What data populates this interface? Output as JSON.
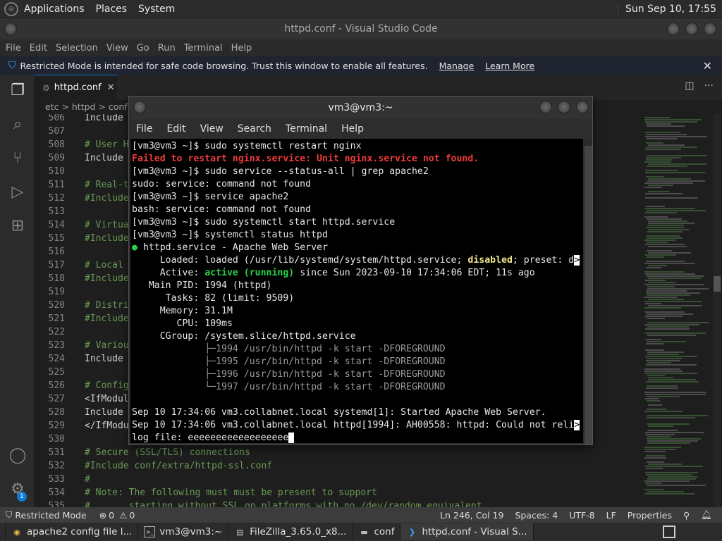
{
  "topbar": {
    "menus": [
      "Applications",
      "Places",
      "System"
    ],
    "clock": "Sun Sep 10, 17:55"
  },
  "window": {
    "title": "httpd.conf - Visual Studio Code"
  },
  "menubar": [
    "File",
    "Edit",
    "Selection",
    "View",
    "Go",
    "Run",
    "Terminal",
    "Help"
  ],
  "banner": {
    "text": "Restricted Mode is intended for safe code browsing. Trust this window to enable all features.",
    "manage": "Manage",
    "learn": "Learn More"
  },
  "tab": {
    "label": "httpd.conf"
  },
  "breadcrumb": "etc > httpd > conf >",
  "editor": {
    "lines": [
      {
        "n": "506",
        "t": "Include",
        "c": false
      },
      {
        "n": "507",
        "t": "",
        "c": false
      },
      {
        "n": "508",
        "t": "# User H",
        "c": true
      },
      {
        "n": "509",
        "t": "Include ",
        "c": false
      },
      {
        "n": "510",
        "t": "",
        "c": false
      },
      {
        "n": "511",
        "t": "# Real-t",
        "c": true
      },
      {
        "n": "512",
        "t": "#Include",
        "c": true
      },
      {
        "n": "513",
        "t": "",
        "c": false
      },
      {
        "n": "514",
        "t": "# Virtua",
        "c": true
      },
      {
        "n": "515",
        "t": "#Include",
        "c": true
      },
      {
        "n": "516",
        "t": "",
        "c": false
      },
      {
        "n": "517",
        "t": "# Local ",
        "c": true
      },
      {
        "n": "518",
        "t": "#Include",
        "c": true
      },
      {
        "n": "519",
        "t": "",
        "c": false
      },
      {
        "n": "520",
        "t": "# Distri",
        "c": true
      },
      {
        "n": "521",
        "t": "#Include",
        "c": true
      },
      {
        "n": "522",
        "t": "",
        "c": false
      },
      {
        "n": "523",
        "t": "# Variou",
        "c": true
      },
      {
        "n": "524",
        "t": "Include ",
        "c": false
      },
      {
        "n": "525",
        "t": "",
        "c": false
      },
      {
        "n": "526",
        "t": "# Config",
        "c": true
      },
      {
        "n": "527",
        "t": "<IfModul",
        "c": false
      },
      {
        "n": "528",
        "t": "Include ",
        "c": false
      },
      {
        "n": "529",
        "t": "</IfModu",
        "c": false
      },
      {
        "n": "530",
        "t": "",
        "c": false
      },
      {
        "n": "531",
        "t": "# Secure (SSL/TLS) connections",
        "c": true
      },
      {
        "n": "532",
        "t": "#Include conf/extra/httpd-ssl.conf",
        "c": true
      },
      {
        "n": "533",
        "t": "#",
        "c": true
      },
      {
        "n": "534",
        "t": "# Note: The following must must be present to support",
        "c": true
      },
      {
        "n": "535",
        "t": "#       starting without SSL on platforms with no /dev/random equivalent",
        "c": true
      }
    ]
  },
  "status": {
    "restricted": "Restricted Mode",
    "problems": "0",
    "warnings": "0",
    "position": "Ln 246, Col 19",
    "spaces": "Spaces: 4",
    "encoding": "UTF-8",
    "eol": "LF",
    "language": "Properties"
  },
  "activity_badge": "1",
  "terminal": {
    "title": "vm3@vm3:~",
    "menus": [
      "File",
      "Edit",
      "View",
      "Search",
      "Terminal",
      "Help"
    ],
    "lines": {
      "l1": "[vm3@vm3 ~]$ sudo systemctl restart nginx",
      "l2": "Failed to restart nginx.service: Unit nginx.service not found.",
      "l3": "[vm3@vm3 ~]$ sudo service --status-all | grep apache2",
      "l4": "sudo: service: command not found",
      "l5": "[vm3@vm3 ~]$ service apache2",
      "l6": "bash: service: command not found",
      "l7": "[vm3@vm3 ~]$ sudo systemctl start httpd.service",
      "l8": "[vm3@vm3 ~]$ systemctl status httpd",
      "l9_dot": "●",
      "l9": " httpd.service - Apache Web Server",
      "l10a": "     Loaded: loaded (/usr/lib/systemd/system/httpd.service; ",
      "l10b": "disabled",
      "l10c": "; preset: d",
      "l11a": "     Active: ",
      "l11b": "active (running)",
      "l11c": " since Sun 2023-09-10 17:34:06 EDT; 11s ago",
      "l12": "   Main PID: 1994 (httpd)",
      "l13": "      Tasks: 82 (limit: 9509)",
      "l14": "     Memory: 31.1M",
      "l15": "        CPU: 109ms",
      "l16": "     CGroup: /system.slice/httpd.service",
      "l17": "             ├─1994 /usr/bin/httpd -k start -DFOREGROUND",
      "l18": "             ├─1995 /usr/bin/httpd -k start -DFOREGROUND",
      "l19": "             ├─1996 /usr/bin/httpd -k start -DFOREGROUND",
      "l20": "             └─1997 /usr/bin/httpd -k start -DFOREGROUND",
      "l21": "",
      "l22": "Sep 10 17:34:06 vm3.collabnet.local systemd[1]: Started Apache Web Server.",
      "l23": "Sep 10 17:34:06 vm3.collabnet.local httpd[1994]: AH00558: httpd: Could not reli",
      "l24": "log file: eeeeeeeeeeeeeeeeee",
      "trunc": ">"
    }
  },
  "taskbar": [
    {
      "label": "apache2 config file l...",
      "icon": "chrome-icon"
    },
    {
      "label": "vm3@vm3:~",
      "icon": "terminal-icon"
    },
    {
      "label": "FileZilla_3.65.0_x8...",
      "icon": "filezilla-icon"
    },
    {
      "label": "conf",
      "icon": "folder-icon"
    },
    {
      "label": "httpd.conf - Visual S...",
      "icon": "vscode-icon"
    }
  ]
}
